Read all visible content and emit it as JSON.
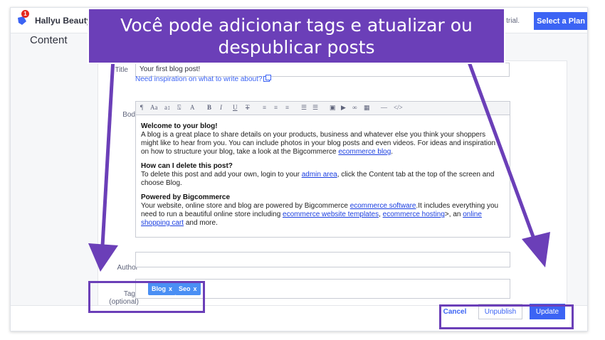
{
  "topbar": {
    "store_name": "Hallyu Beauty",
    "notification_count": "1",
    "trial_text": "r trial.",
    "select_plan_label": "Select a Plan"
  },
  "page": {
    "heading": "Content"
  },
  "form": {
    "title_label": "Title",
    "title_value": "Your first blog post!",
    "inspiration_link": "Need inspiration on what to write about?",
    "body_label": "Body",
    "author_label": "Author",
    "tags_label": "Tags (optional)",
    "tags": [
      {
        "label": "Blog",
        "remove": "x"
      },
      {
        "label": "Seo",
        "remove": "x"
      }
    ]
  },
  "toolbar": {
    "paragraph": "¶",
    "font_family": "Aa",
    "font_size": "a↕",
    "format": "⍂",
    "color": "A",
    "bold": "B",
    "italic": "I",
    "underline": "U",
    "strike": "T",
    "align_left": "≡",
    "align_center": "≡",
    "align_right": "≡",
    "ordered_list": "☰",
    "unordered_list": "☰",
    "image": "▣",
    "video": "▶",
    "link": "∞",
    "table": "▦",
    "hr": "—",
    "code": "</>"
  },
  "editor": {
    "h1": "Welcome to your blog!",
    "p1": "A blog is a great place to share details on your products, business and whatever else you think your shoppers might like to hear from you. You can include photos in your blog posts and even videos. For ideas and inspiration on how to structure your blog, take a look at the Bigcommerce ",
    "p1_link": "ecommerce blog",
    "p1_end": ".",
    "h2": "How can I delete this post?",
    "p2_start": "To delete this post and add your own, login to your ",
    "p2_link": "admin area",
    "p2_end": ", click the Content tab at the top of the screen and choose Blog.",
    "h3": "Powered by Bigcommerce",
    "p3_start": "Your website, online store and blog are powered by Bigcommerce ",
    "p3_link1": "ecommerce software",
    "p3_mid1": ".It includes everything you need to run a beautiful online store including ",
    "p3_link2": "ecommerce website templates",
    "p3_mid2": ", ",
    "p3_link3": "ecommerce hosting",
    "p3_mid3": ">, an ",
    "p3_link4": "online shopping cart",
    "p3_end": " and more."
  },
  "footer": {
    "cancel_label": "Cancel",
    "unpublish_label": "Unpublish",
    "update_label": "Update"
  },
  "annotation": {
    "banner_line1": "Você pode adicionar tags e atualizar ou",
    "banner_line2": "despublicar posts",
    "color": "#6b3fb8"
  }
}
